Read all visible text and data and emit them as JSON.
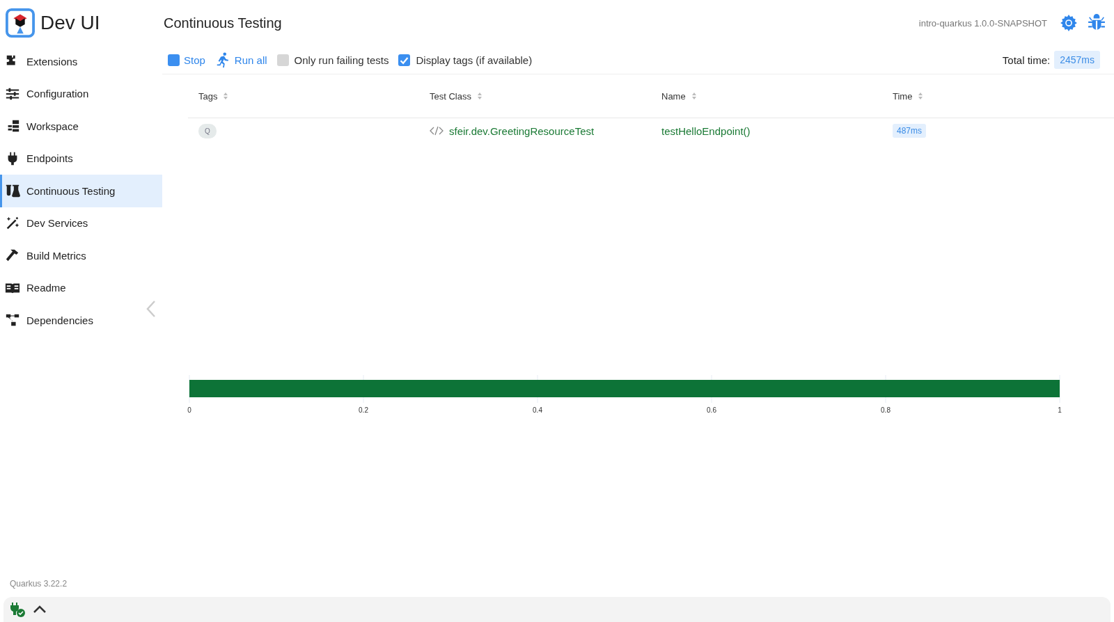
{
  "app": {
    "title": "Dev UI",
    "version": "Quarkus 3.22.2"
  },
  "sidebar": {
    "items": [
      {
        "label": "Extensions",
        "selected": false
      },
      {
        "label": "Configuration",
        "selected": false
      },
      {
        "label": "Workspace",
        "selected": false
      },
      {
        "label": "Endpoints",
        "selected": false
      },
      {
        "label": "Continuous Testing",
        "selected": true
      },
      {
        "label": "Dev Services",
        "selected": false
      },
      {
        "label": "Build Metrics",
        "selected": false
      },
      {
        "label": "Readme",
        "selected": false
      },
      {
        "label": "Dependencies",
        "selected": false
      }
    ]
  },
  "header": {
    "page_title": "Continuous Testing",
    "app_name": "intro-quarkus 1.0.0-SNAPSHOT"
  },
  "toolbar": {
    "stop": "Stop",
    "run_all": "Run all",
    "options": [
      {
        "label": "Only run failing tests",
        "checked": false
      },
      {
        "label": "Display tags (if available)",
        "checked": true
      }
    ],
    "total_time_label": "Total time:",
    "total_time": "2457ms"
  },
  "table": {
    "columns": [
      "Tags",
      "Test Class",
      "Name",
      "Time"
    ],
    "rows": [
      {
        "tags": [
          "Q"
        ],
        "test_class": "sfeir.dev.GreetingResourceTest",
        "name": "testHelloEndpoint()",
        "time": "487ms"
      }
    ]
  },
  "results_chart": {
    "chart_data": {
      "type": "bar",
      "orientation": "horizontal",
      "stacked": true,
      "grid": true,
      "xlim": [
        0,
        1
      ],
      "xticks": [
        0,
        0.2,
        0.4,
        0.6,
        0.8,
        1
      ],
      "series": [
        {
          "color": "#0d7337",
          "values": [
            1
          ]
        }
      ]
    }
  }
}
